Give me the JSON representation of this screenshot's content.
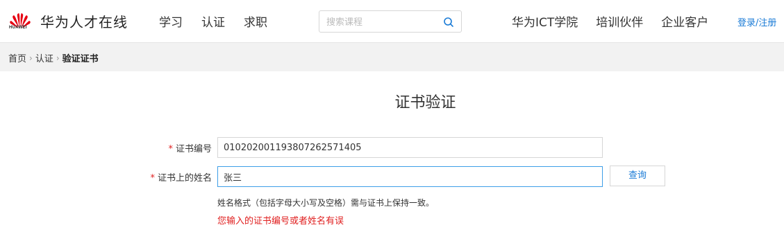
{
  "header": {
    "logo_text": "HUAWEI",
    "site_title": "华为人才在线",
    "nav_left": [
      "学习",
      "认证",
      "求职"
    ],
    "search_placeholder": "搜索课程",
    "nav_right": [
      "华为ICT学院",
      "培训伙伴",
      "企业客户"
    ],
    "login_label": "登录/注册"
  },
  "breadcrumb": {
    "items": [
      "首页",
      "认证",
      "验证证书"
    ]
  },
  "main": {
    "title": "证书验证",
    "cert_number_label": "证书编号",
    "cert_number_value": "0102020011938072625714​05",
    "name_label": "证书上的姓名",
    "name_value": "张三",
    "query_button": "查询",
    "hint": "姓名格式（包括字母大小写及空格）需与证书上保持一致。",
    "error": "您输入的证书编号或者姓名有误"
  },
  "colors": {
    "accent": "#1a7bd6",
    "error": "#e02020",
    "logo_red": "#e60012"
  }
}
